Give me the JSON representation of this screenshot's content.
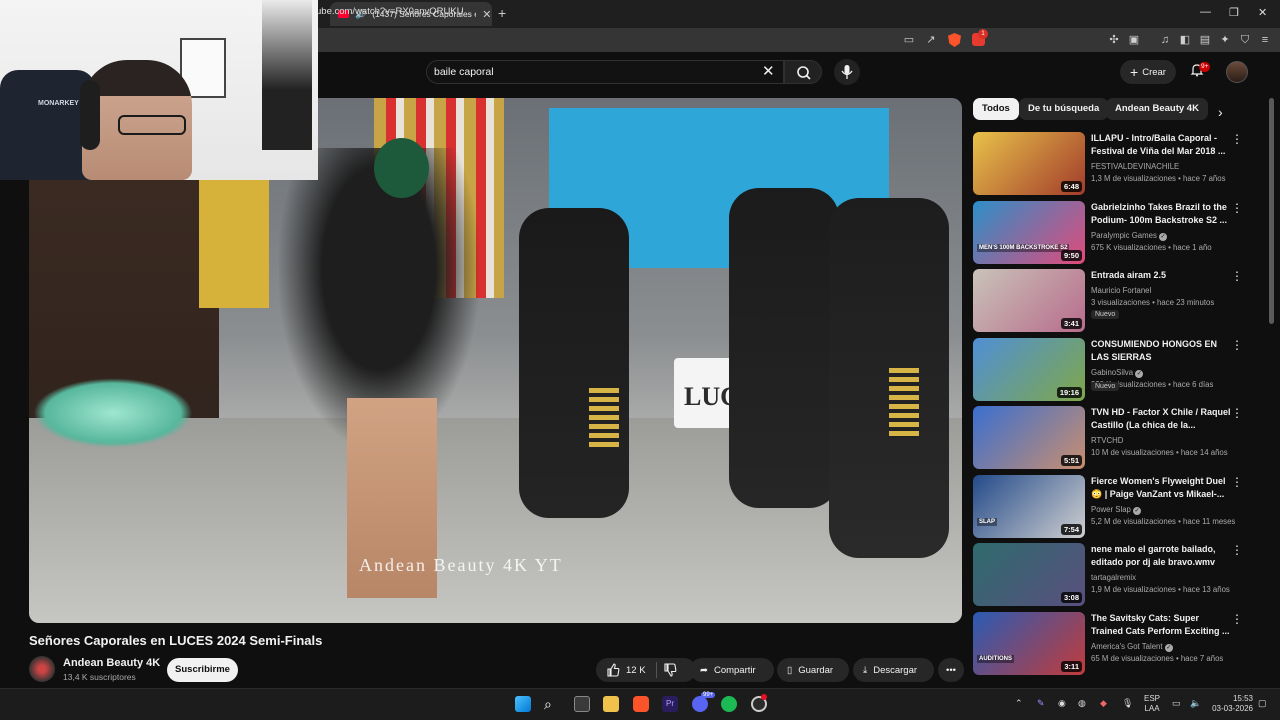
{
  "browser": {
    "tab_title": "(1437) Señores Caporales en L",
    "url": "ube.com/watch?v=RX0anvQRUKU",
    "new_tab_icon": "plus-icon",
    "notification_count": "1"
  },
  "header": {
    "search_value": "baile caporal",
    "create_label": "Crear",
    "notif_badge": "9+"
  },
  "video": {
    "title": "Señores Caporales en LUCES 2024 Semi-Finals",
    "watermark": "Andean Beauty 4K YT",
    "stage_sign": "LUCES",
    "channel_name": "Andean Beauty 4K",
    "subscribers": "13,4 K suscriptores",
    "subscribe_label": "Suscribirme",
    "likes": "12 K",
    "share_label": "Compartir",
    "save_label": "Guardar",
    "download_label": "Descargar"
  },
  "webcam": {
    "chair_brand": "MONARKEY"
  },
  "chips": [
    "Todos",
    "De tu búsqueda",
    "Andean Beauty 4K"
  ],
  "recommendations": [
    {
      "title": "ILLAPU - Intro/Baila Caporal - Festival de Viña del Mar 2018 ...",
      "channel": "FESTIVALDEVINACHILE",
      "meta": "1,3 M de visualizaciones • hace 7 años",
      "duration": "6:48",
      "badge": "",
      "verified": false,
      "thumb": [
        "#e8c24a",
        "#a23b2b"
      ]
    },
    {
      "title": "Gabrielzinho Takes Brazil to the Podium- 100m Backstroke S2 ...",
      "channel": "Paralympic Games",
      "meta": "675 K visualizaciones • hace 1 año",
      "duration": "9:50",
      "badge": "",
      "verified": true,
      "thumb": [
        "#2c8fc9",
        "#e14a7a"
      ],
      "thumb_text": "MEN'S 100M BACKSTROKE S2"
    },
    {
      "title": "Entrada airam 2.5",
      "channel": "Mauricio Fortanel",
      "meta": "3 visualizaciones • hace 23 minutos",
      "duration": "3:41",
      "badge": "Nuevo",
      "verified": false,
      "thumb": [
        "#c9c3b8",
        "#b86b8c"
      ]
    },
    {
      "title": "CONSUMIENDO HONGOS EN LAS SIERRAS",
      "channel": "GabinoSilva",
      "meta": "320 K visualizaciones • hace 6 días",
      "duration": "19:16",
      "badge": "Nuevo",
      "verified": true,
      "thumb": [
        "#4f8fd6",
        "#7fa84a"
      ]
    },
    {
      "title": "TVN HD - Factor X Chile / Raquel Castillo (La chica de la...",
      "channel": "RTVCHD",
      "meta": "10 M de visualizaciones • hace 14 años",
      "duration": "5:51",
      "badge": "",
      "verified": false,
      "thumb": [
        "#3a6fd0",
        "#c98e6f"
      ]
    },
    {
      "title": "Fierce Women's Flyweight Duel 😳 | Paige VanZant vs Mikael-...",
      "channel": "Power Slap",
      "meta": "5,2 M de visualizaciones • hace 11 meses",
      "duration": "7:54",
      "badge": "",
      "verified": true,
      "thumb": [
        "#234a8a",
        "#d0d0d0"
      ],
      "thumb_text": "SLAP"
    },
    {
      "title": "nene malo el garrote bailado, editado por dj ale bravo.wmv",
      "channel": "tartagalremix",
      "meta": "1,9 M de visualizaciones • hace 13 años",
      "duration": "3:08",
      "badge": "",
      "verified": false,
      "thumb": [
        "#2e6b6d",
        "#5a4f7e"
      ]
    },
    {
      "title": "The Savitsky Cats: Super Trained Cats Perform Exciting ...",
      "channel": "America's Got Talent",
      "meta": "65 M de visualizaciones • hace 7 años",
      "duration": "3:11",
      "badge": "",
      "verified": true,
      "thumb": [
        "#2a5bb3",
        "#c23b3b"
      ],
      "thumb_text": "AUDITIONS"
    }
  ],
  "taskbar": {
    "lang_top": "ESP",
    "lang_bottom": "LAA",
    "time": "15:53",
    "date": "03-03-2026",
    "edge_badge": "99+"
  }
}
